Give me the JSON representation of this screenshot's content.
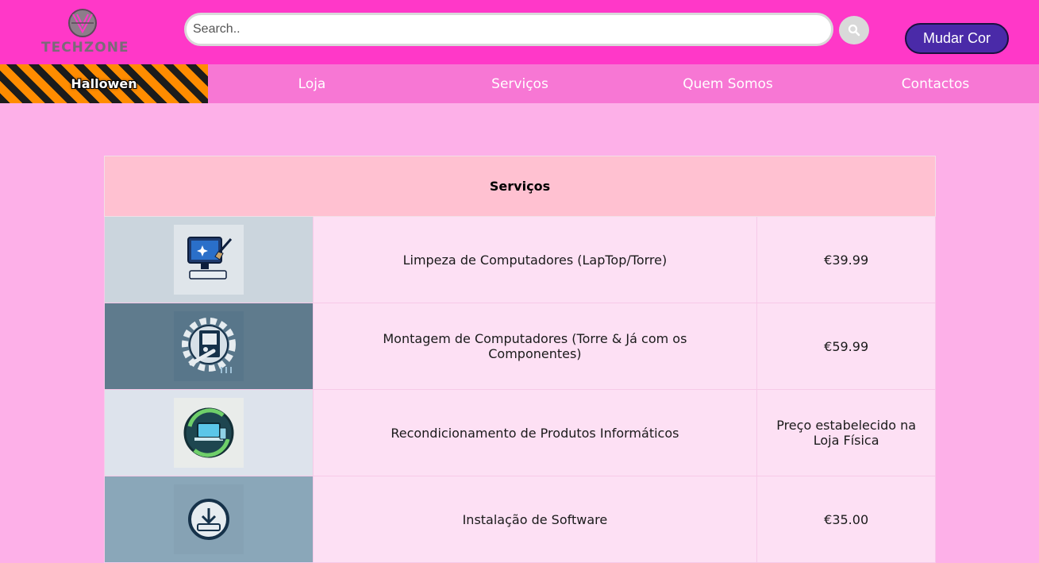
{
  "header": {
    "logo_text": "TECHZONE",
    "search": {
      "placeholder": "Search.."
    },
    "search_icon": "search-icon",
    "color_button_label": "Mudar Cor",
    "colors": {
      "header": "#ff38c8",
      "nav": "#f777d4",
      "button": "#4a2aa8",
      "page": "#fdb0e8"
    }
  },
  "nav": {
    "items": [
      {
        "label": "Hallowen"
      },
      {
        "label": "Loja"
      },
      {
        "label": "Serviços"
      },
      {
        "label": "Quem Somos"
      },
      {
        "label": "Contactos"
      }
    ]
  },
  "services": {
    "title": "Serviços",
    "rows": [
      {
        "icon": "computer-cleaning-icon",
        "name": "Limpeza de Computadores (LapTop/Torre)",
        "price": "€39.99",
        "bg": "#cbd5dd"
      },
      {
        "icon": "computer-assembly-icon",
        "name": "Montagem de Computadores (Torre & Já com os Componentes)",
        "price": "€59.99",
        "bg": "#5f7b8d"
      },
      {
        "icon": "refurbish-icon",
        "name": "Recondicionamento de Produtos Informáticos",
        "price": "Preço estabelecido na Loja Física",
        "bg": "#dde3ec"
      },
      {
        "icon": "software-install-icon",
        "name": "Instalação de Software",
        "price": "€35.00",
        "bg": "#8aa7b9"
      }
    ]
  }
}
